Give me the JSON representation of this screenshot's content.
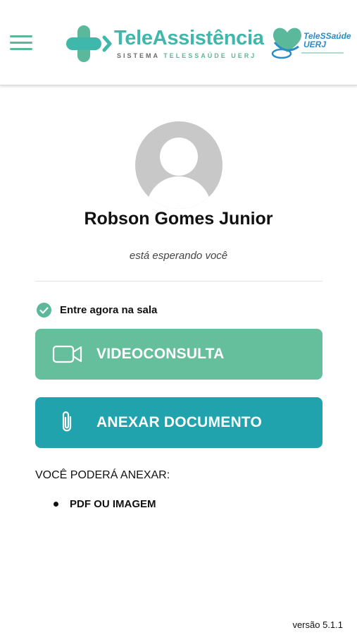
{
  "header": {
    "menu_icon": "hamburger-icon",
    "logo": {
      "title": "TeleAssistência",
      "subtitle_part1": "SISTEMA",
      "subtitle_part2": "TELESSAÚDE UERJ"
    },
    "partner_logo": {
      "line1": "TeleSSaúde",
      "line2": "UERJ"
    }
  },
  "doctor": {
    "avatar_icon": "user-avatar-icon",
    "name": "Robson Gomes Junior",
    "status": "está esperando você"
  },
  "enter": {
    "icon": "check-circle-icon",
    "label": "Entre agora na sala"
  },
  "buttons": {
    "video": {
      "icon": "video-camera-icon",
      "label": "VIDEOCONSULTA",
      "color": "#66bf9c"
    },
    "attach": {
      "icon": "paperclip-icon",
      "label": "ANEXAR DOCUMENTO",
      "color": "#20a3ad"
    }
  },
  "attachments": {
    "heading": "VOCÊ PODERÁ ANEXAR:",
    "items": [
      "PDF OU IMAGEM"
    ]
  },
  "footer": {
    "version": "versão 5.1.1"
  },
  "colors": {
    "brand_green": "#5bb89a",
    "brand_teal": "#3fb8ab",
    "partner_blue": "#2a8dc5"
  }
}
